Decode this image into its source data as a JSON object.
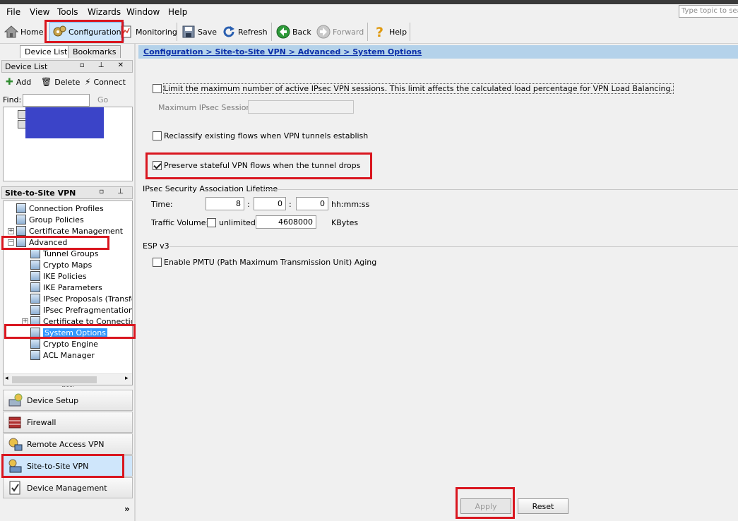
{
  "menubar": {
    "items": [
      "File",
      "View",
      "Tools",
      "Wizards",
      "Window",
      "Help"
    ],
    "search_placeholder": "Type topic to sea"
  },
  "toolbar": {
    "home": "Home",
    "configuration": "Configuration",
    "monitoring": "Monitoring",
    "save": "Save",
    "refresh": "Refresh",
    "back": "Back",
    "forward": "Forward",
    "help": "Help"
  },
  "left_panel": {
    "tabs": [
      "Device List",
      "Bookmarks"
    ],
    "device_list": {
      "title": "Device List",
      "add": "Add",
      "delete": "Delete",
      "connect": "Connect",
      "find_label": "Find:",
      "go": "Go"
    },
    "section_title": "Site-to-Site VPN",
    "tree": [
      {
        "label": "Connection Profiles",
        "level": 0,
        "icon": "connection-profiles-icon"
      },
      {
        "label": "Group Policies",
        "level": 0,
        "icon": "group-policies-icon"
      },
      {
        "label": "Certificate Management",
        "level": 0,
        "icon": "certificate-icon",
        "expander": "+"
      },
      {
        "label": "Advanced",
        "level": 0,
        "icon": "advanced-icon",
        "expander": "−"
      },
      {
        "label": "Tunnel Groups",
        "level": 1,
        "icon": "tunnel-groups-icon"
      },
      {
        "label": "Crypto Maps",
        "level": 1,
        "icon": "crypto-maps-icon"
      },
      {
        "label": "IKE Policies",
        "level": 1,
        "icon": "ike-policies-icon"
      },
      {
        "label": "IKE Parameters",
        "level": 1,
        "icon": "ike-parameters-icon"
      },
      {
        "label": "IPsec Proposals (Transfor",
        "level": 1,
        "icon": "ipsec-proposals-icon"
      },
      {
        "label": "IPsec Prefragmentation Po",
        "level": 1,
        "icon": "ipsec-prefrag-icon"
      },
      {
        "label": "Certificate to Connection I",
        "level": 1,
        "icon": "cert-map-icon",
        "expander": "+"
      },
      {
        "label": "System Options",
        "level": 1,
        "icon": "system-options-icon",
        "selected": true
      },
      {
        "label": "Crypto Engine",
        "level": 1,
        "icon": "crypto-engine-icon"
      },
      {
        "label": "ACL Manager",
        "level": 1,
        "icon": "acl-manager-icon"
      }
    ],
    "nav_buttons": [
      "Device Setup",
      "Firewall",
      "Remote Access VPN",
      "Site-to-Site VPN",
      "Device Management"
    ],
    "more": "»"
  },
  "breadcrumb": {
    "text": "Configuration > Site-to-Site VPN > Advanced > System Options"
  },
  "main": {
    "limit_sessions_label": "Limit the maximum number of active IPsec VPN sessions. This limit affects the calculated load percentage for VPN Load Balancing.",
    "max_sessions_label": "Maximum IPsec Sessions:",
    "max_sessions_value": "",
    "reclassify_label": "Reclassify existing flows when VPN tunnels establish",
    "preserve_label": "Preserve stateful VPN flows when the tunnel drops",
    "sa_group_title": "IPsec Security Association Lifetime",
    "time_label": "Time:",
    "time_hours": "8",
    "time_minutes": "0",
    "time_seconds": "0",
    "colon": ":",
    "time_unit": "hh:mm:ss",
    "traffic_label": "Traffic Volume:",
    "unlimited_label": "unlimited",
    "traffic_value": "4608000",
    "traffic_unit": "KBytes",
    "esp_title": "ESP v3",
    "pmtu_label": "Enable PMTU (Path Maximum Transmission Unit) Aging",
    "apply": "Apply",
    "reset": "Reset"
  },
  "state": {
    "limit_sessions_checked": false,
    "reclassify_checked": false,
    "preserve_checked": true,
    "unlimited_checked": false,
    "pmtu_checked": false
  },
  "colors": {
    "highlight_box": "#d9161f",
    "breadcrumb_bg": "#b4d2ea",
    "selection": "#3399ff",
    "redacted_block": "#3b44c8"
  }
}
